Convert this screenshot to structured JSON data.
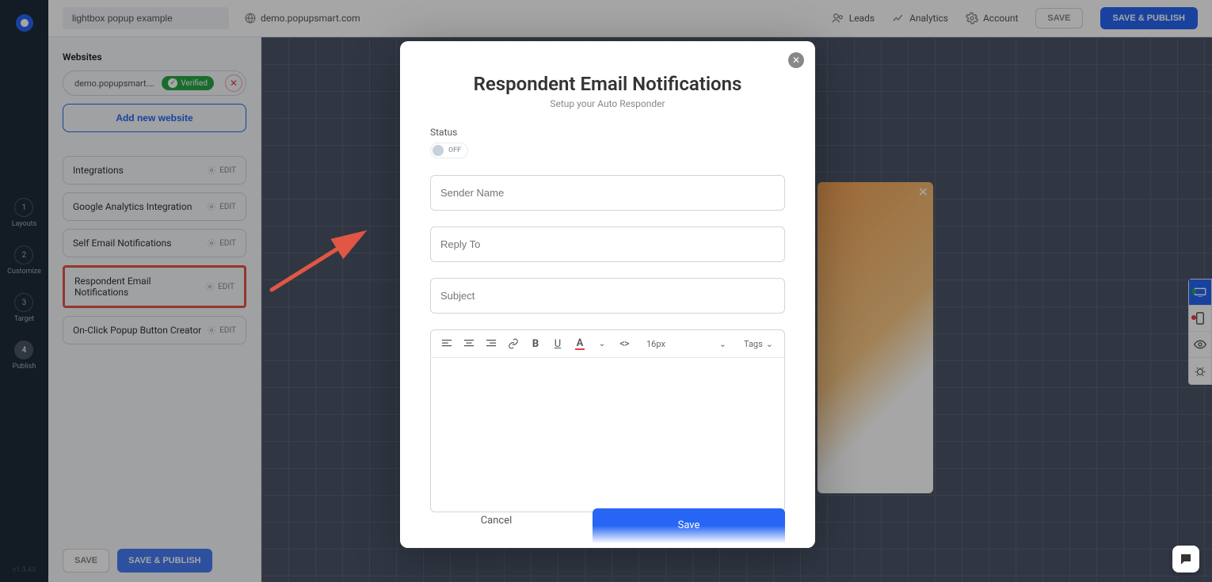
{
  "header": {
    "campaign_name": "lightbox popup example",
    "domain": "demo.popupsmart.com",
    "nav": {
      "leads": "Leads",
      "analytics": "Analytics",
      "account": "Account"
    },
    "save": "SAVE",
    "save_publish": "SAVE & PUBLISH"
  },
  "left_rail": {
    "steps": [
      {
        "n": "1",
        "label": "Layouts"
      },
      {
        "n": "2",
        "label": "Customize"
      },
      {
        "n": "3",
        "label": "Target"
      },
      {
        "n": "4",
        "label": "Publish"
      }
    ],
    "version": "v1.3.43"
  },
  "sidebar": {
    "websites_label": "Websites",
    "website": {
      "domain": "demo.popupsmart.c…",
      "verified": "Verified"
    },
    "add_website": "Add new website",
    "items": [
      {
        "label": "Integrations",
        "edit": "EDIT"
      },
      {
        "label": "Google Analytics Integration",
        "edit": "EDIT"
      },
      {
        "label": "Self Email Notifications",
        "edit": "EDIT"
      },
      {
        "label": "Respondent Email Notifications",
        "edit": "EDIT"
      },
      {
        "label": "On-Click Popup Button Creator",
        "edit": "EDIT"
      }
    ],
    "footer": {
      "save": "SAVE",
      "save_publish": "SAVE & PUBLISH"
    }
  },
  "modal": {
    "title": "Respondent Email Notifications",
    "subtitle": "Setup your Auto Responder",
    "status_label": "Status",
    "status_state": "OFF",
    "fields": {
      "sender": "Sender Name",
      "reply_to": "Reply To",
      "subject": "Subject"
    },
    "toolbar": {
      "font_size": "16px",
      "tags": "Tags"
    },
    "cancel": "Cancel",
    "save": "Save"
  }
}
